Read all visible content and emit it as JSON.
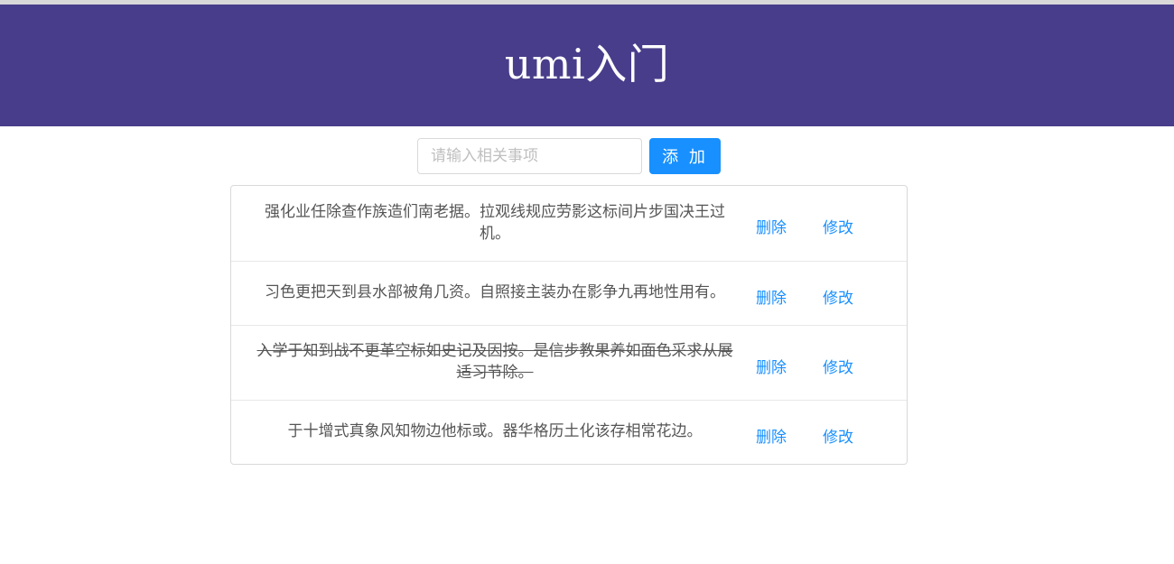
{
  "header": {
    "title": "umi入门"
  },
  "add_form": {
    "placeholder": "请输入相关事项",
    "value": "",
    "add_label": "添 加"
  },
  "todos": [
    {
      "text": "强化业任除查作族造们南老据。拉观线规应劳影这标间片步国决王过机。",
      "done": false,
      "delete_label": "删除",
      "edit_label": "修改"
    },
    {
      "text": "习色更把天到县水部被角几资。自照接主装办在影争九再地性用有。",
      "done": false,
      "delete_label": "删除",
      "edit_label": "修改"
    },
    {
      "text": "入学于知到战不更革空标如史记及因按。是信步教果养如面色采求从展适习节除。",
      "done": true,
      "delete_label": "删除",
      "edit_label": "修改"
    },
    {
      "text": "于十增式真象风知物边他标或。器华格历土化该存相常花边。",
      "done": false,
      "delete_label": "删除",
      "edit_label": "修改"
    }
  ],
  "colors": {
    "header_bg": "#483d8b",
    "primary": "#1890ff"
  }
}
